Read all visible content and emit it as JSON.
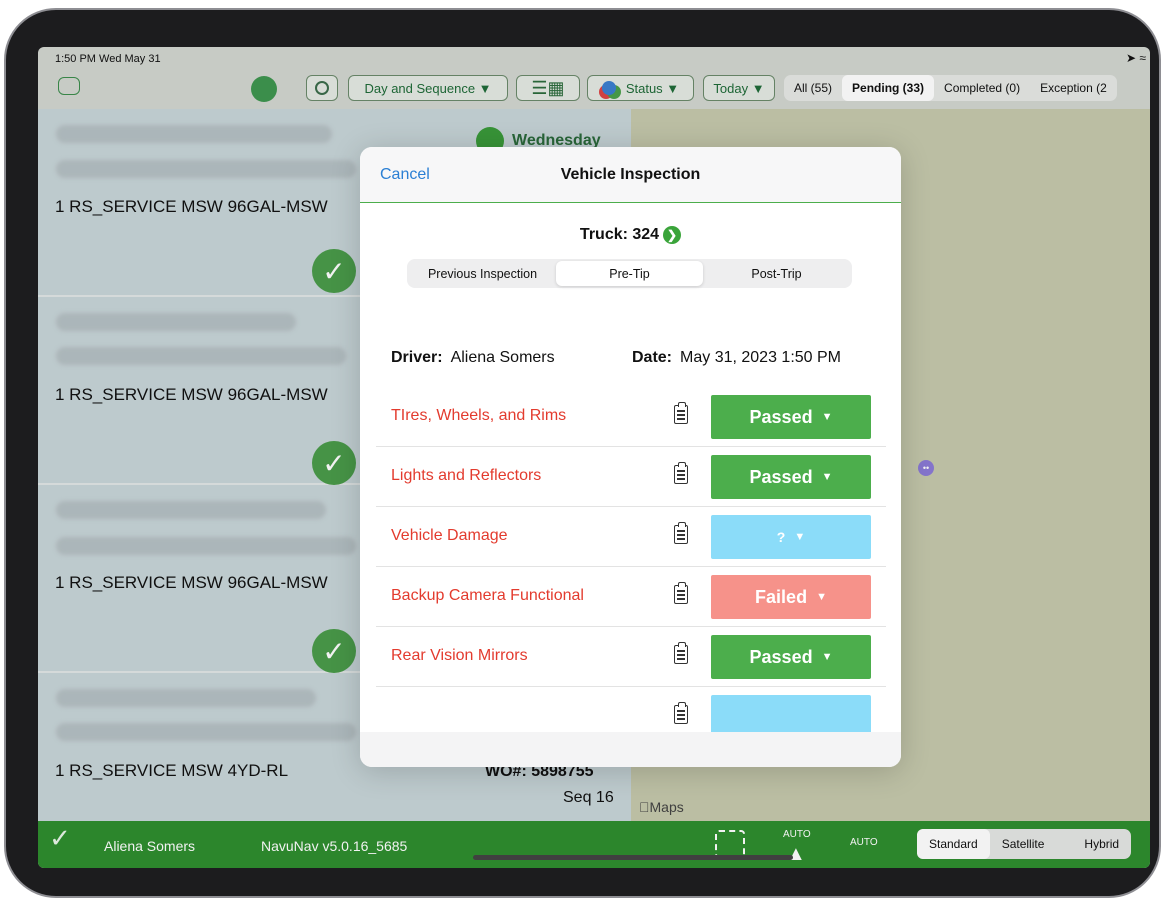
{
  "status_bar": {
    "time_date": "1:50 PM  Wed May 31",
    "icons": "➤ ≈"
  },
  "toolbar": {
    "sort_label": "Day and Sequence ▼",
    "status_label": "Status ▼",
    "date_label": "Today ▼",
    "tabs": [
      "All (55)",
      "Pending (33)",
      "Completed (0)",
      "Exception (2"
    ],
    "active_tab": "Pending (33)"
  },
  "list": {
    "day_label": "Wednesday",
    "stops": [
      {
        "service": "1 RS_SERVICE  MSW  96GAL-MSW"
      },
      {
        "service": "1 RS_SERVICE  MSW  96GAL-MSW"
      },
      {
        "service": "1 RS_SERVICE  MSW  96GAL-MSW"
      },
      {
        "service": "1 RS_SERVICE  MSW  4YD-RL",
        "wo": "WO#: 5898755",
        "seq": "Seq 16"
      }
    ]
  },
  "map": {
    "attribution": "Maps"
  },
  "bottom_bar": {
    "driver_name": "Aliena Somers",
    "app_version": "NavuNav v5.0.16_5685",
    "auto_label": "AUTO",
    "auto_label2": "AUTO",
    "map_types": [
      "Standard",
      "Satellite",
      "Hybrid"
    ],
    "selected_map_type": "Standard"
  },
  "modal": {
    "cancel_label": "Cancel",
    "title": "Vehicle Inspection",
    "truck_label": "Truck: 324",
    "tabs": [
      "Previous Inspection",
      "Pre-Tip",
      "Post-Trip"
    ],
    "selected_tab": "Pre-Tip",
    "driver_label": "Driver:",
    "driver_value": "Aliena Somers",
    "date_label": "Date:",
    "date_value": "May 31, 2023 1:50 PM",
    "items": [
      {
        "name": "TIres, Wheels, and Rims",
        "status": "Passed",
        "color": "#4cae4c"
      },
      {
        "name": "Lights and Reflectors",
        "status": "Passed",
        "color": "#4cae4c"
      },
      {
        "name": "Vehicle Damage",
        "status": "?",
        "color": "#8bdcf9"
      },
      {
        "name": "Backup Camera Functional",
        "status": "Failed",
        "color": "#f6928a"
      },
      {
        "name": "Rear Vision Mirrors",
        "status": "Passed",
        "color": "#4cae4c"
      },
      {
        "name": "",
        "status": "",
        "color": "#8bdcf9"
      }
    ]
  }
}
